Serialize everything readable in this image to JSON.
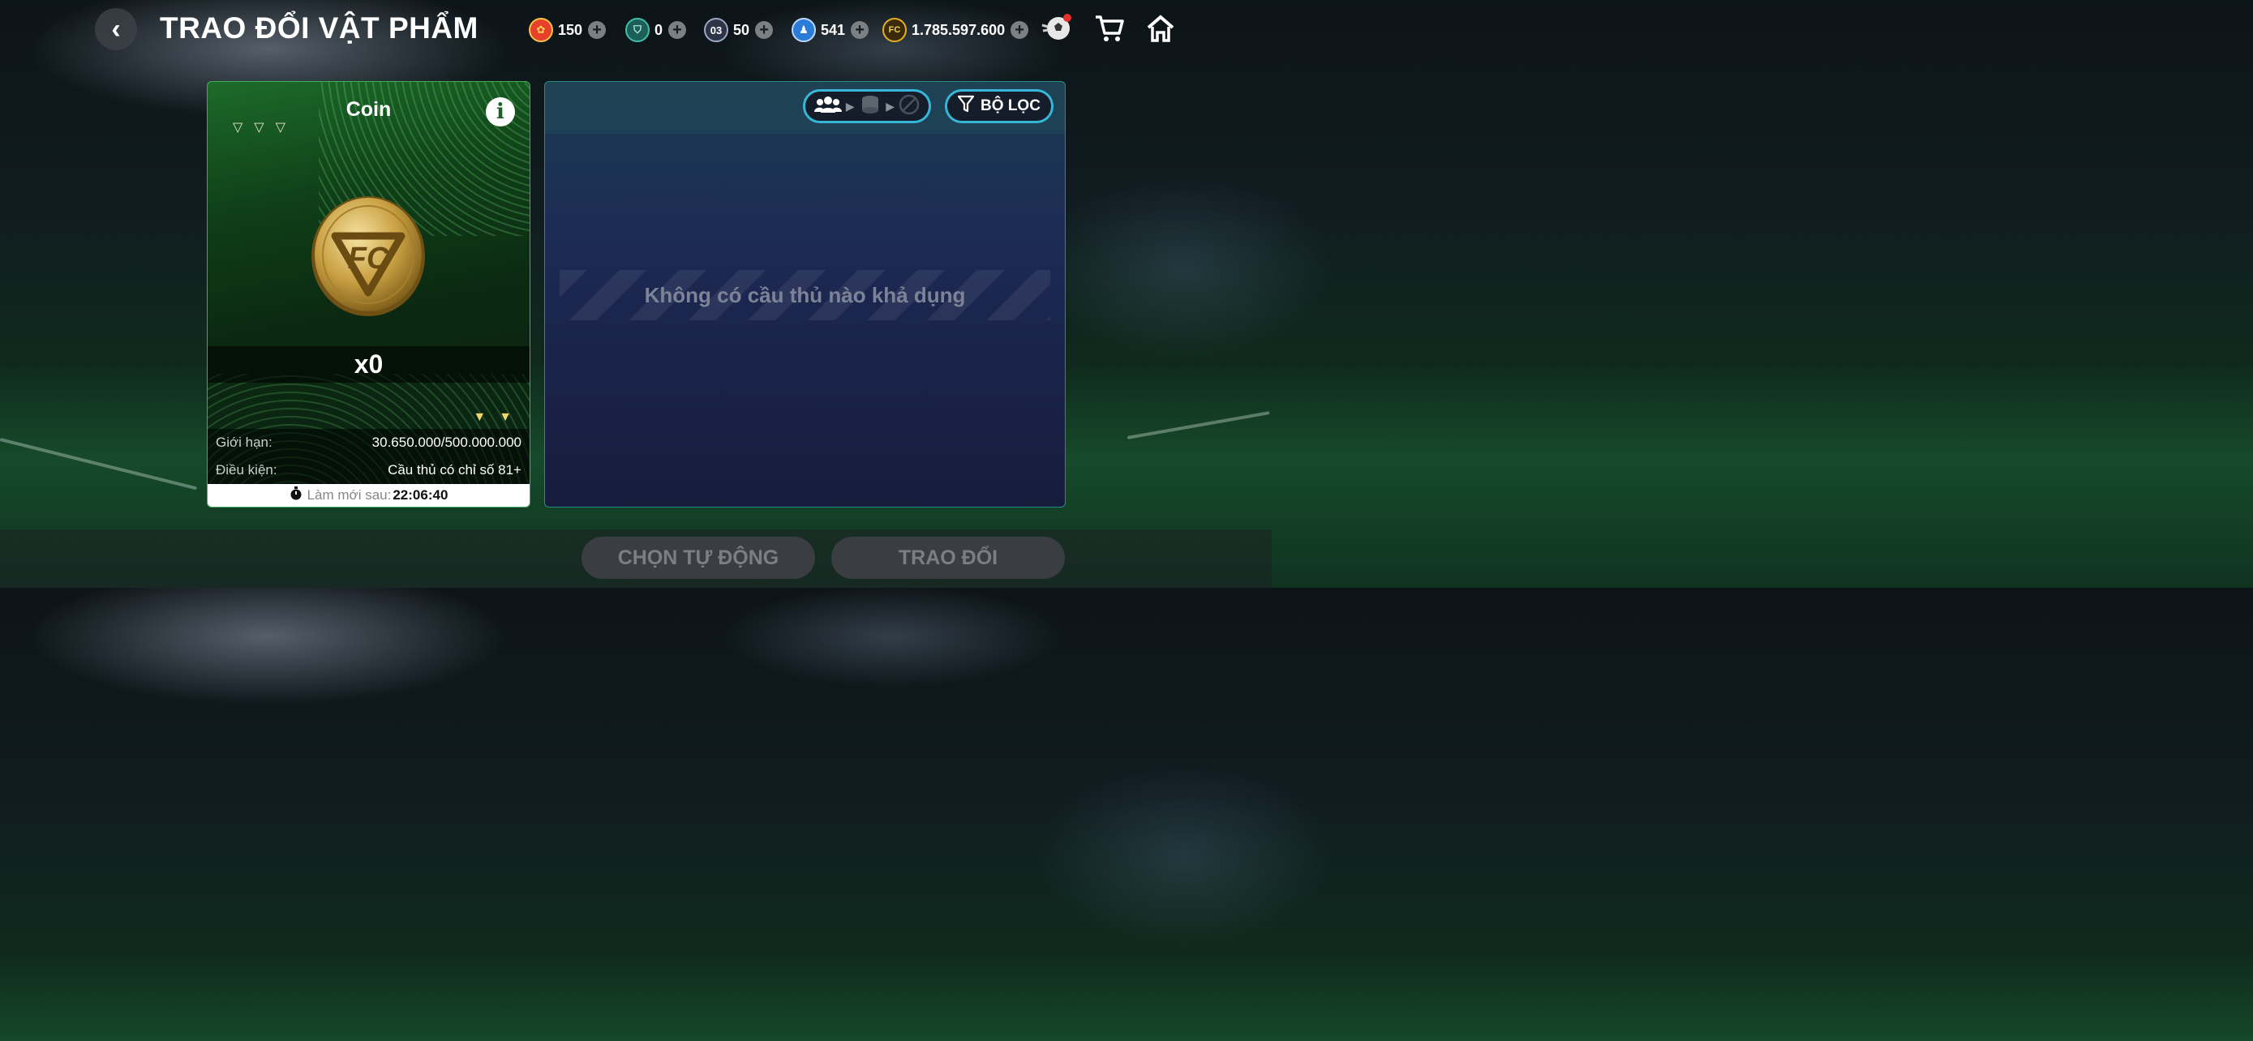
{
  "header": {
    "title": "TRAO ĐỔI VẬT PHẨM",
    "back_icon": "chevron-left-icon"
  },
  "resources": [
    {
      "name": "puzzle-token",
      "value": "150",
      "color": "#e8412b"
    },
    {
      "name": "shield-token",
      "value": "0",
      "color": "#3fbfa8"
    },
    {
      "name": "card-token",
      "value": "50",
      "label": "03",
      "color": "#5a6d8e"
    },
    {
      "name": "player-token",
      "value": "541",
      "color": "#2b7bd9"
    },
    {
      "name": "fc-coin",
      "value": "1.785.597.600",
      "color": "#e3b21c"
    }
  ],
  "card": {
    "title": "Coin",
    "quantity": "x0",
    "limit_label": "Giới hạn:",
    "limit_value": "30.650.000/500.000.000",
    "condition_label": "Điều kiện:",
    "condition_value": "Cầu thủ có chỉ số 81+",
    "refresh_label": "Làm mới sau:",
    "refresh_time": "22:06:40"
  },
  "panel": {
    "empty_message": "Không có cầu thủ nào khả dụng",
    "filter_label": "BỘ LỌC"
  },
  "buttons": {
    "auto_select": "CHỌN TỰ ĐỘNG",
    "exchange": "TRAO ĐỔI"
  },
  "colors": {
    "accent": "#37b6d9",
    "card_green": "#1d6b2a",
    "coin_gold": "#d7b04a"
  }
}
